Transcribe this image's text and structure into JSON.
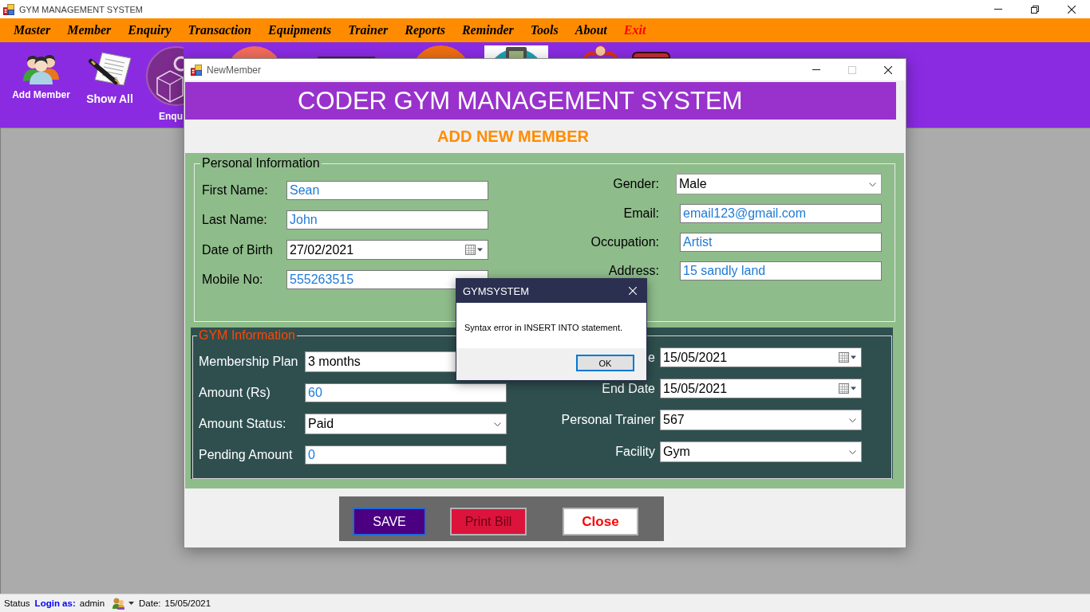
{
  "main_window": {
    "title": "GYM MANAGEMENT SYSTEM",
    "window_controls": [
      {
        "kind": "minimize",
        "disabled": false
      },
      {
        "kind": "restore",
        "disabled": false
      },
      {
        "kind": "close",
        "disabled": false
      }
    ]
  },
  "menu": [
    {
      "label": "Master",
      "kind": "menu"
    },
    {
      "label": "Member",
      "kind": "menu"
    },
    {
      "label": "Enquiry",
      "kind": "menu"
    },
    {
      "label": "Transaction",
      "kind": "menu"
    },
    {
      "label": "Equipments",
      "kind": "menu"
    },
    {
      "label": "Trainer",
      "kind": "menu"
    },
    {
      "label": "Reports",
      "kind": "menu"
    },
    {
      "label": "Reminder",
      "kind": "menu"
    },
    {
      "label": "Tools",
      "kind": "menu"
    },
    {
      "label": "About",
      "kind": "menu"
    },
    {
      "label": "Exit",
      "kind": "exit"
    }
  ],
  "toolbar": [
    {
      "label": "Add Member"
    },
    {
      "label": "Show All"
    },
    {
      "label": "Enqu"
    }
  ],
  "new_member_window": {
    "title": "NewMember",
    "window_controls": [
      {
        "kind": "minimize",
        "disabled": false
      },
      {
        "kind": "maximize",
        "disabled": true
      },
      {
        "kind": "close",
        "disabled": false
      }
    ],
    "banner": "CODER GYM MANAGEMENT SYSTEM",
    "heading": "ADD NEW MEMBER",
    "personal_information": {
      "legend": "Personal Information",
      "left_fields": [
        {
          "label": "First Name:",
          "kind": "text",
          "value": "Sean"
        },
        {
          "label": "Last Name:",
          "kind": "text",
          "value": "John"
        },
        {
          "label": "Date of Birth",
          "kind": "date",
          "value": "27/02/2021"
        },
        {
          "label": "Mobile No:",
          "kind": "text",
          "value": "555263515"
        }
      ],
      "right_fields": [
        {
          "label": "Gender:",
          "kind": "combo",
          "value": "Male"
        },
        {
          "label": "Email:",
          "kind": "text",
          "value": "email123@gmail.com"
        },
        {
          "label": "Occupation:",
          "kind": "text",
          "value": "Artist"
        },
        {
          "label": "Address:",
          "kind": "text",
          "value": "15 sandly land"
        }
      ]
    },
    "gym_information": {
      "legend": "GYM Information",
      "left_fields": [
        {
          "label": "Membership Plan",
          "kind": "plain",
          "value": "3 months"
        },
        {
          "label": "Amount (Rs)",
          "kind": "text",
          "value": "60"
        },
        {
          "label": "Amount Status:",
          "kind": "combo",
          "value": "Paid"
        },
        {
          "label": "Pending Amount",
          "kind": "text",
          "value": "0"
        }
      ],
      "right_fields": [
        {
          "label": "e",
          "kind": "date",
          "value": "15/05/2021"
        },
        {
          "label": "End Date",
          "kind": "date",
          "value": "15/05/2021"
        },
        {
          "label": "Personal Trainer",
          "kind": "combo",
          "value": "567"
        },
        {
          "label": "Facility",
          "kind": "combo",
          "value": "Gym"
        }
      ]
    },
    "buttons": [
      {
        "label": "SAVE",
        "kind": "save",
        "focused": true
      },
      {
        "label": "Print Bill",
        "kind": "print",
        "focused": false
      },
      {
        "label": "Close",
        "kind": "close",
        "focused": false
      }
    ]
  },
  "message_box": {
    "title": "GYMSYSTEM",
    "window_controls": [
      {
        "kind": "close",
        "disabled": false
      }
    ],
    "message": "Syntax error in INSERT INTO statement.",
    "button": {
      "label": "OK",
      "focused": true
    }
  },
  "status_bar": {
    "status": "Status",
    "login_label": "Login as:",
    "user": "admin",
    "date_label": "Date:",
    "date": "15/05/2021"
  }
}
